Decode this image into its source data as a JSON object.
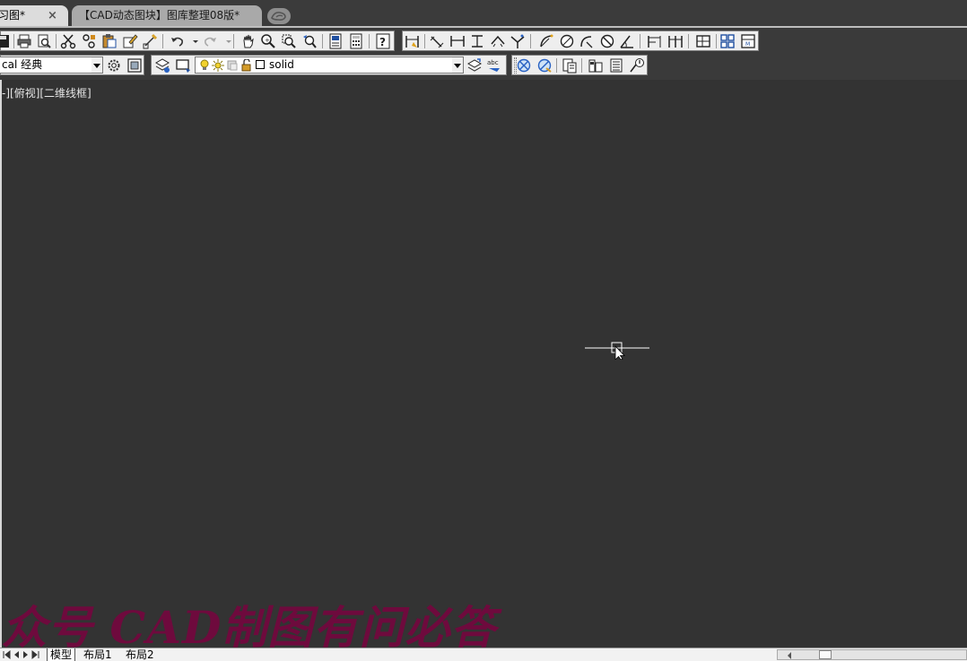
{
  "tabs": {
    "active_label": "习图*",
    "close_glyph": "×",
    "second_label": "【CAD动态图块】图库整理08版*"
  },
  "toolbar": {
    "workspace_value": "cal 经典",
    "layer_value": "solid"
  },
  "viewport": {
    "label": "-][俯视][二维线框]",
    "watermark": "众号 CAD制图有问必答"
  },
  "layout_tabs": {
    "model": "模型",
    "layout1": "布局1",
    "layout2": "布局2"
  },
  "colors": {
    "canvas": "#333333",
    "watermark": "#6e0a3d",
    "toolbar_bg": "#eeeeee"
  }
}
